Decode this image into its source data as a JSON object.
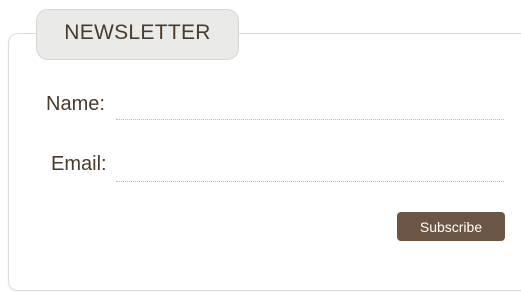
{
  "newsletter": {
    "title": "NEWSLETTER",
    "fields": {
      "name_label": "Name:",
      "name_value": "",
      "email_label": "Email:",
      "email_value": ""
    },
    "subscribe_label": "Subscribe"
  },
  "colors": {
    "text": "#4a3a2c",
    "tab_background": "#eaebe9",
    "button_background": "#6b5646",
    "button_text": "#ffffff",
    "border": "#dcdcdc"
  }
}
